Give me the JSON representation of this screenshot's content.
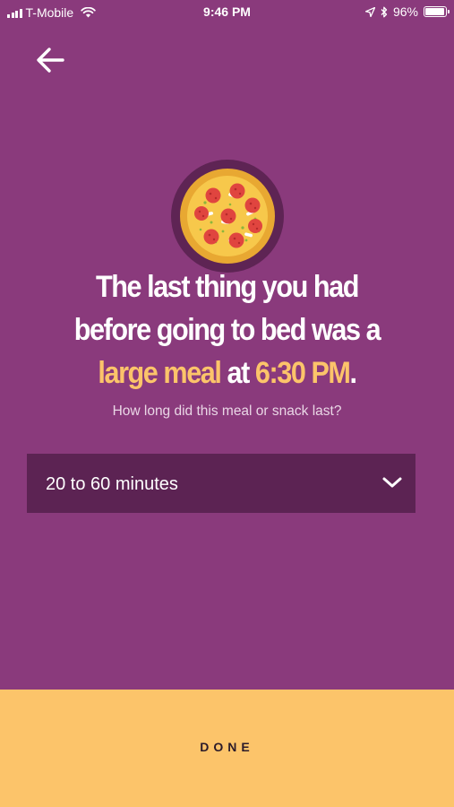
{
  "status_bar": {
    "carrier": "T-Mobile",
    "time": "9:46 PM",
    "battery": "96%",
    "battery_level": 0.96
  },
  "icons": {
    "back": "arrow-left-icon",
    "pizza": "pizza-icon",
    "dropdown": "chevron-down-icon",
    "signal": "signal-icon",
    "wifi": "wifi-icon",
    "location": "location-arrow-icon",
    "bluetooth": "bluetooth-icon",
    "battery": "battery-icon"
  },
  "headline": {
    "line1": "The last thing you had",
    "line2": "before going to bed was a",
    "meal_size": "large meal",
    "at_word": "at",
    "meal_time": "6:30 PM",
    "end_punct": "."
  },
  "question": "How long did this meal or snack last?",
  "duration_select": {
    "value": "20 to 60 minutes"
  },
  "done_label": "DONE",
  "colors": {
    "background": "#8a3a7c",
    "accent": "#fcc46a",
    "select_background": "#5c2353",
    "text": "#ffffff"
  }
}
